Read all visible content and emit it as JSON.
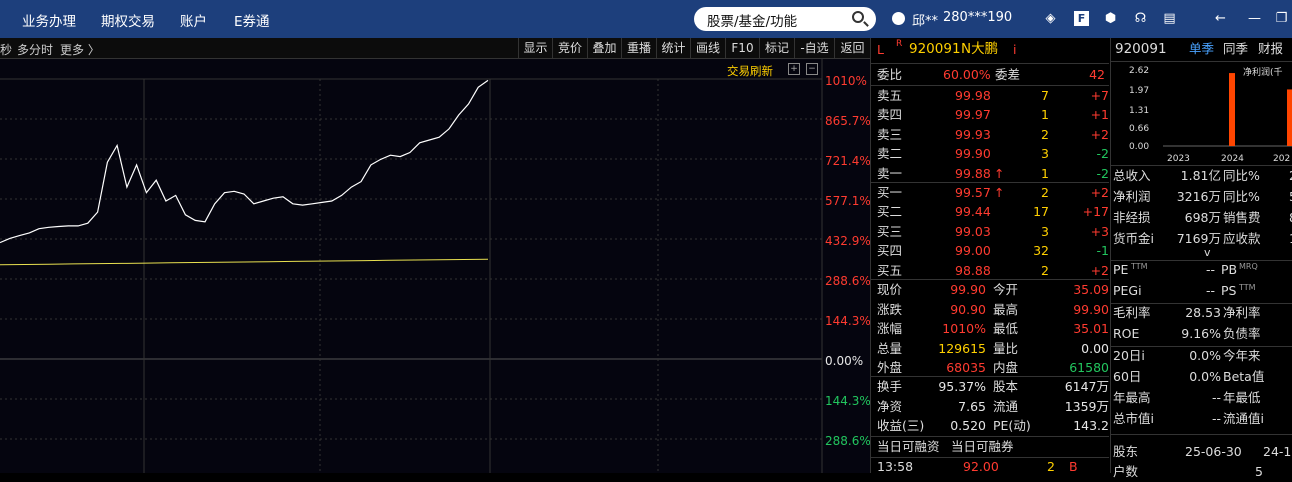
{
  "topbar": {
    "menu": [
      "业务办理",
      "期权交易",
      "账户",
      "E券通"
    ],
    "search_placeholder": "股票/基金/功能",
    "user": "邱**",
    "account": "280***190",
    "icons": [
      "layers-icon",
      "f-icon",
      "hexagon-icon",
      "headset-icon",
      "message-icon",
      "back-arrow-icon",
      "window-restore-icon"
    ]
  },
  "chartbar": {
    "left_text": "秒",
    "view_label": "多分时",
    "more_label": "更多 〉",
    "tools": [
      "显示",
      "竞价",
      "叠加",
      "重播",
      "统计",
      "画线",
      "F10",
      "标记",
      "-自选",
      "返回"
    ]
  },
  "chart": {
    "refresh_label": "交易刷新",
    "pct_labels": [
      "1010%",
      "865.7%",
      "721.4%",
      "577.1%",
      "432.9%",
      "288.6%",
      "144.3%",
      "0.00%",
      "144.3%",
      "288.6%"
    ],
    "chart_data": {
      "type": "line",
      "series": [
        {
          "name": "",
          "values": [
            420,
            435,
            445,
            455,
            470,
            475,
            478,
            480,
            480,
            490,
            530,
            710,
            770,
            620,
            700,
            600,
            645,
            570,
            590,
            520,
            500,
            495,
            560,
            600,
            605,
            595,
            560,
            570,
            580,
            585,
            560,
            555,
            560,
            565,
            570,
            590,
            620,
            640,
            700,
            720,
            735,
            730,
            745,
            780,
            790,
            800,
            830,
            880,
            920,
            980,
            1005
          ]
        },
        {
          "name": "",
          "values": [
            340,
            341,
            342,
            343,
            344,
            345,
            346,
            347,
            348,
            349,
            350,
            351,
            352,
            353,
            354,
            355,
            356,
            357,
            358,
            359,
            360
          ]
        }
      ],
      "ylim": [
        -288.6,
        1010
      ]
    }
  },
  "quote": {
    "flag_l": "L",
    "flag_r": "R",
    "code": "920091",
    "name": "N大鹏",
    "info": "i",
    "weibi_label": "委比",
    "weibi": "60.00%",
    "weicha_label": "委差",
    "weicha": "42",
    "sells": [
      {
        "label": "卖五",
        "price": "99.98",
        "vol": "7",
        "chg": "+7"
      },
      {
        "label": "卖四",
        "price": "99.97",
        "vol": "1",
        "chg": "+1"
      },
      {
        "label": "卖三",
        "price": "99.93",
        "vol": "2",
        "chg": "+2"
      },
      {
        "label": "卖二",
        "price": "99.90",
        "vol": "3",
        "chg": "-2"
      },
      {
        "label": "卖一",
        "price": "99.88",
        "vol": "1",
        "chg": "-2",
        "arrow": "↑"
      }
    ],
    "buys": [
      {
        "label": "买一",
        "price": "99.57",
        "vol": "2",
        "chg": "+2",
        "arrow": "↑"
      },
      {
        "label": "买二",
        "price": "99.44",
        "vol": "17",
        "chg": "+17"
      },
      {
        "label": "买三",
        "price": "99.03",
        "vol": "3",
        "chg": "+3"
      },
      {
        "label": "买四",
        "price": "99.00",
        "vol": "32",
        "chg": "-1"
      },
      {
        "label": "买五",
        "price": "98.88",
        "vol": "2",
        "chg": "+2"
      }
    ],
    "stats": [
      [
        "现价",
        "99.90",
        "今开",
        "35.09"
      ],
      [
        "涨跌",
        "90.90",
        "最高",
        "99.90"
      ],
      [
        "涨幅",
        "1010%",
        "最低",
        "35.01"
      ],
      [
        "总量",
        "129615",
        "量比",
        "0.00"
      ],
      [
        "外盘",
        "68035",
        "内盘",
        "61580"
      ]
    ],
    "stats2": [
      [
        "换手",
        "95.37%",
        "股本",
        "6147万"
      ],
      [
        "净资",
        "7.65",
        "流通",
        "1359万"
      ],
      [
        "收益(三)",
        "0.520",
        "PE(动)",
        "143.2"
      ]
    ],
    "rz_label1": "当日可融资",
    "rz_label2": "当日可融券",
    "tick": {
      "time": "13:58",
      "price": "92.00",
      "vol": "2",
      "dir": "B"
    }
  },
  "fin": {
    "code": "920091",
    "tabs": [
      "单季",
      "同季",
      "财报"
    ],
    "chart_title": "净利润(千",
    "chart_data": {
      "type": "bar",
      "categories": [
        "2023",
        "2024",
        "202"
      ],
      "values": [
        0,
        2.45,
        1.9
      ],
      "ylim": [
        0,
        2.62
      ],
      "yticks": [
        "2.62",
        "1.97",
        "1.31",
        "0.66",
        "0.00"
      ]
    },
    "rows": [
      [
        "总收入",
        "1.81亿",
        "同比%",
        "2"
      ],
      [
        "净利润",
        "3216万",
        "同比%",
        "5"
      ],
      [
        "非经损",
        "698万",
        "销售费",
        "8"
      ],
      [
        "货币金i",
        "7169万",
        "应收款",
        "1"
      ]
    ],
    "chevron": "v",
    "rows2": [
      [
        "PE",
        "TTM",
        "--",
        "PB",
        "MRQ"
      ],
      [
        "PEGi",
        "",
        "--",
        "PS",
        "TTM"
      ]
    ],
    "rows3": [
      [
        "毛利率",
        "28.53",
        "净利率",
        ""
      ],
      [
        "ROE",
        "9.16%",
        "负债率",
        ""
      ]
    ],
    "rows4": [
      [
        "20日i",
        "0.0%",
        "今年来"
      ],
      [
        "60日",
        "0.0%",
        "Beta值"
      ],
      [
        "年最高",
        "--",
        "年最低"
      ],
      [
        "总市值i",
        "--",
        "流通值i"
      ]
    ],
    "holder": {
      "label": "股东",
      "d1": "25-06-30",
      "d2": "24-1"
    },
    "last_label": "户数",
    "last_val": "5"
  }
}
